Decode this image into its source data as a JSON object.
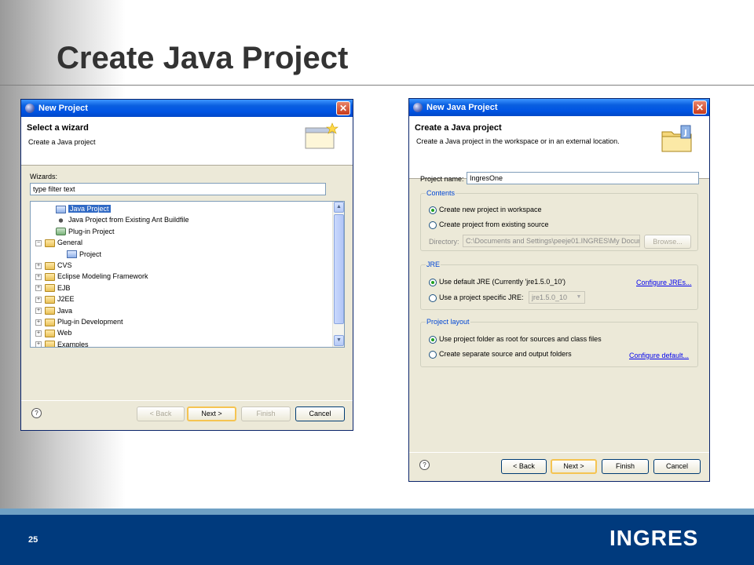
{
  "slide": {
    "title": "Create Java Project",
    "page_number": "25",
    "logo": "INGRES"
  },
  "dialog1": {
    "title": "New Project",
    "header_title": "Select a wizard",
    "header_desc": "Create a Java project",
    "wizards_label": "Wizards:",
    "filter_value": "type filter text",
    "tree": [
      {
        "label": "Java Project",
        "indent": 1,
        "expander": "",
        "icon": "proj",
        "selected": true
      },
      {
        "label": "Java Project from Existing Ant Buildfile",
        "indent": 1,
        "expander": "",
        "icon": "ant",
        "selected": false
      },
      {
        "label": "Plug-in Project",
        "indent": 1,
        "expander": "",
        "icon": "plug",
        "selected": false
      },
      {
        "label": "General",
        "indent": 0,
        "expander": "−",
        "icon": "folder",
        "selected": false
      },
      {
        "label": "Project",
        "indent": 2,
        "expander": "",
        "icon": "proj",
        "selected": false
      },
      {
        "label": "CVS",
        "indent": 0,
        "expander": "+",
        "icon": "folder",
        "selected": false
      },
      {
        "label": "Eclipse Modeling Framework",
        "indent": 0,
        "expander": "+",
        "icon": "folder",
        "selected": false
      },
      {
        "label": "EJB",
        "indent": 0,
        "expander": "+",
        "icon": "folder",
        "selected": false
      },
      {
        "label": "J2EE",
        "indent": 0,
        "expander": "+",
        "icon": "folder",
        "selected": false
      },
      {
        "label": "Java",
        "indent": 0,
        "expander": "+",
        "icon": "folder",
        "selected": false
      },
      {
        "label": "Plug-in Development",
        "indent": 0,
        "expander": "+",
        "icon": "folder",
        "selected": false
      },
      {
        "label": "Web",
        "indent": 0,
        "expander": "+",
        "icon": "folder",
        "selected": false
      },
      {
        "label": "Examples",
        "indent": 0,
        "expander": "+",
        "icon": "folder",
        "selected": false
      }
    ],
    "buttons": {
      "back": "< Back",
      "next": "Next >",
      "finish": "Finish",
      "cancel": "Cancel"
    },
    "help": "?"
  },
  "dialog2": {
    "title": "New Java Project",
    "header_title": "Create a Java project",
    "header_desc": "Create a Java project in the workspace or in an external location.",
    "project_name_label": "Project name:",
    "project_name_value": "IngresOne",
    "contents": {
      "label": "Contents",
      "option_new": "Create new project in workspace",
      "option_existing": "Create project from existing source",
      "directory_label": "Directory:",
      "directory_value": "C:\\Documents and Settings\\peeje01.INGRES\\My Docum",
      "browse": "Browse..."
    },
    "jre": {
      "label": "JRE",
      "option_default": "Use default JRE (Currently 'jre1.5.0_10')",
      "configure_link": "Configure JREs...",
      "option_specific": "Use a project specific JRE:",
      "specific_value": "jre1.5.0_10"
    },
    "layout": {
      "label": "Project layout",
      "option_root": "Use project folder as root for sources and class files",
      "option_separate": "Create separate source and output folders",
      "configure_link": "Configure default..."
    },
    "buttons": {
      "back": "< Back",
      "next": "Next >",
      "finish": "Finish",
      "cancel": "Cancel"
    },
    "help": "?"
  }
}
